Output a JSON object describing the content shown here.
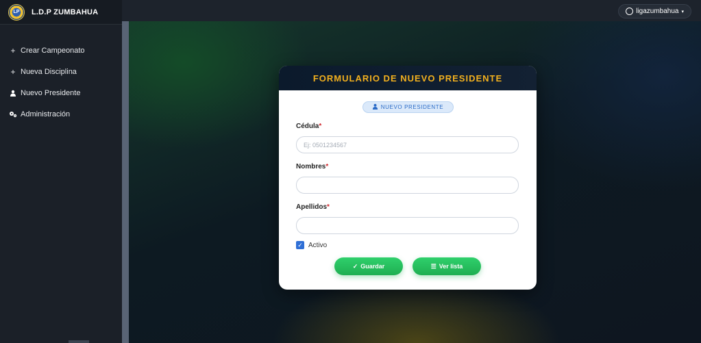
{
  "brand": {
    "name": "L.D.P ZUMBAHUA"
  },
  "sidebar": {
    "items": [
      {
        "icon": "plus-icon",
        "glyph": "+",
        "label": "Crear Campeonato"
      },
      {
        "icon": "plus-icon",
        "glyph": "+",
        "label": "Nueva Disciplina"
      },
      {
        "icon": "user-icon",
        "glyph": "👤",
        "label": "Nuevo Presidente"
      },
      {
        "icon": "gears-icon",
        "glyph": "⚙",
        "label": "Administración"
      }
    ]
  },
  "topbar": {
    "user": "ligazumbahua",
    "caret": "▾"
  },
  "form": {
    "title": "FORMULARIO DE NUEVO PRESIDENTE",
    "badge": "NUEVO PRESIDENTE",
    "fields": {
      "cedula": {
        "label": "Cédula",
        "required_mark": "*",
        "value": "",
        "placeholder": "Ej: 0501234567"
      },
      "nombres": {
        "label": "Nombres",
        "required_mark": "*",
        "value": "",
        "placeholder": ""
      },
      "apellidos": {
        "label": "Apellidos",
        "required_mark": "*",
        "value": "",
        "placeholder": ""
      }
    },
    "activo": {
      "label": "Activo",
      "checked": true,
      "mark": "✓"
    },
    "buttons": {
      "save": {
        "icon": "✓",
        "label": "Guardar"
      },
      "list": {
        "icon": "☰",
        "label": "Ver lista"
      }
    }
  },
  "colors": {
    "accent": "#f2b01e",
    "button": "#1fae52",
    "badge_text": "#2a6bc7",
    "required": "#d0282d"
  }
}
